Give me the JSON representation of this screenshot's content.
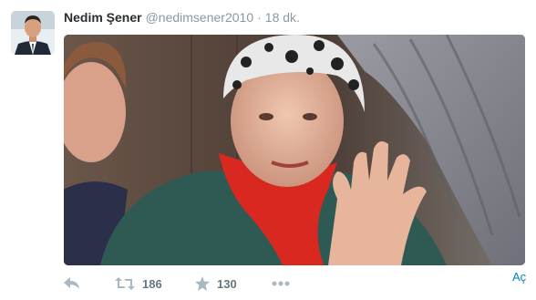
{
  "tweet": {
    "fullname": "Nedim Şener",
    "username": "@nedimsener2010",
    "separator": "·",
    "time": "18 dk."
  },
  "avatar": {
    "icon": "profile-photo"
  },
  "media": {
    "description_icon": "photo-elderly-woman-waving"
  },
  "actions": {
    "reply_icon": "reply-icon",
    "retweet_icon": "retweet-icon",
    "retweet_count": "186",
    "favorite_icon": "star-icon",
    "favorite_count": "130",
    "more_icon": "more-dots-icon",
    "open_label": "Aç"
  },
  "colors": {
    "name": "#292f33",
    "meta": "#8899a6",
    "action_icon": "#aab8c2",
    "link": "#0084b4"
  }
}
